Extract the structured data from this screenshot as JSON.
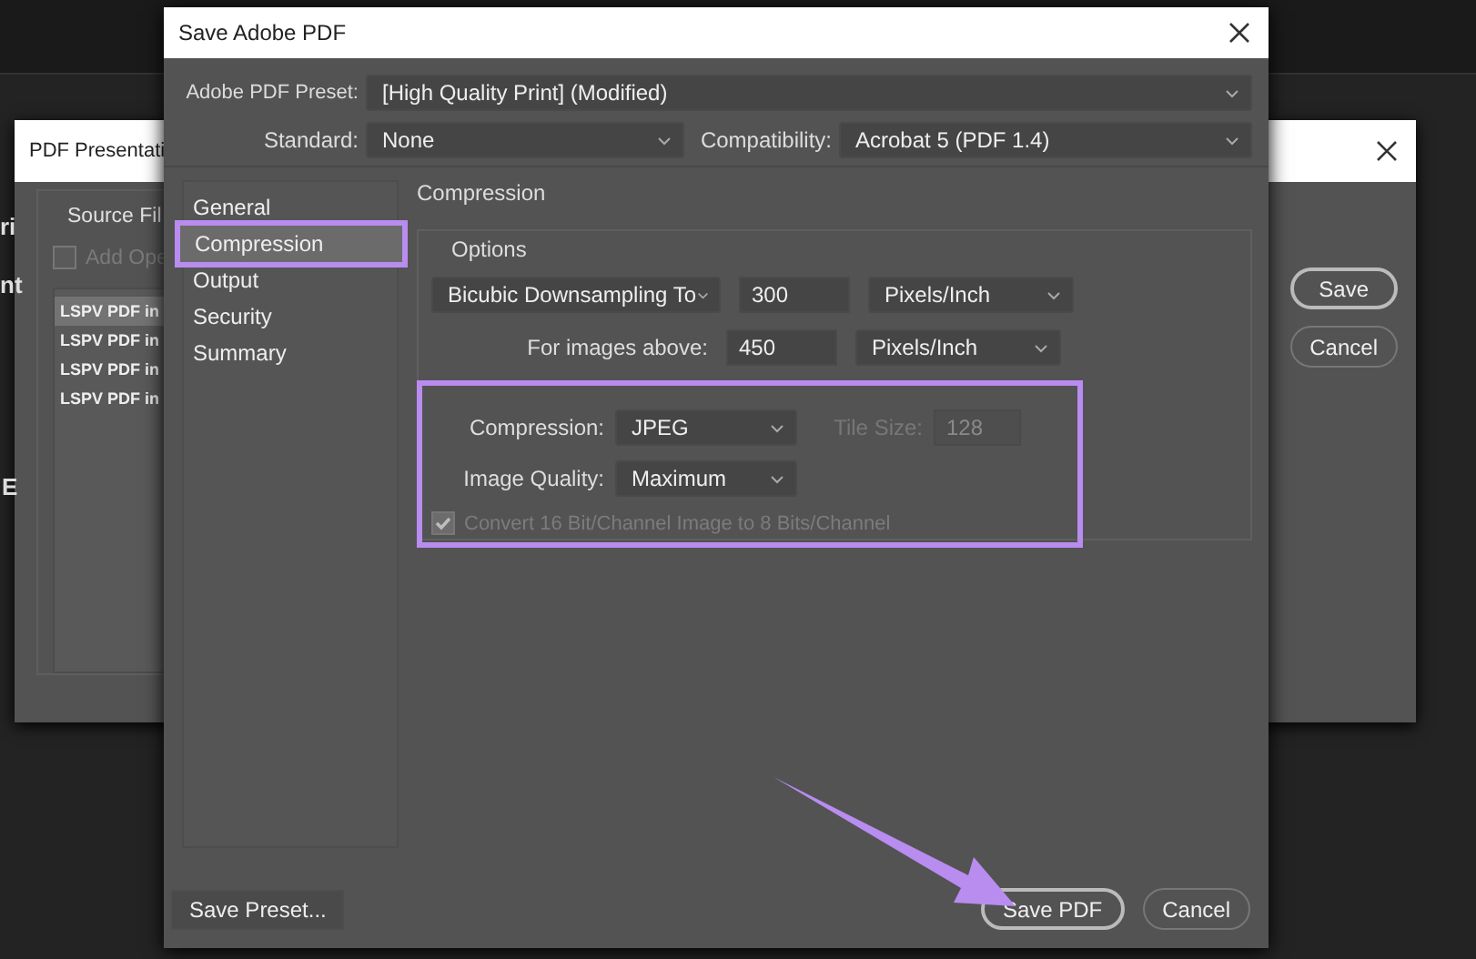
{
  "background_fragments": [
    "ri",
    "nt",
    "E"
  ],
  "back_window": {
    "title": "PDF Presentati",
    "group_label": "Source Fil",
    "add_checkbox": {
      "label": "Add Ope",
      "checked": false,
      "disabled": true
    },
    "files": [
      {
        "name": "LSPV PDF in",
        "selected": true
      },
      {
        "name": "LSPV PDF in",
        "selected": false
      },
      {
        "name": "LSPV PDF in",
        "selected": false
      },
      {
        "name": "LSPV PDF in",
        "selected": false
      }
    ],
    "buttons": [
      "Save",
      "Cancel"
    ]
  },
  "dialog": {
    "title": "Save Adobe PDF",
    "preset": {
      "label": "Adobe PDF Preset:",
      "value": "[High Quality Print] (Modified)"
    },
    "standard": {
      "label": "Standard:",
      "value": "None"
    },
    "compatibility": {
      "label": "Compatibility:",
      "value": "Acrobat 5 (PDF 1.4)"
    },
    "sections": [
      {
        "label": "General",
        "selected": false
      },
      {
        "label": "Compression",
        "selected": true
      },
      {
        "label": "Output",
        "selected": false
      },
      {
        "label": "Security",
        "selected": false
      },
      {
        "label": "Summary",
        "selected": false
      }
    ],
    "section_title": "Compression",
    "options": {
      "legend": "Options",
      "downsampling": {
        "method": "Bicubic Downsampling To",
        "ppi": "300",
        "unit": "Pixels/Inch"
      },
      "above": {
        "label": "For images above:",
        "ppi": "450",
        "unit": "Pixels/Inch"
      },
      "compression": {
        "label": "Compression:",
        "value": "JPEG"
      },
      "tile_size": {
        "label": "Tile Size:",
        "value": "128",
        "disabled": true
      },
      "image_quality": {
        "label": "Image Quality:",
        "value": "Maximum"
      },
      "convert": {
        "label": "Convert 16 Bit/Channel Image to 8 Bits/Channel",
        "checked": true,
        "disabled": true
      }
    },
    "save_preset": "Save Preset...",
    "buttons": [
      {
        "label": "Save PDF",
        "default": true
      },
      {
        "label": "Cancel",
        "default": false
      }
    ]
  }
}
